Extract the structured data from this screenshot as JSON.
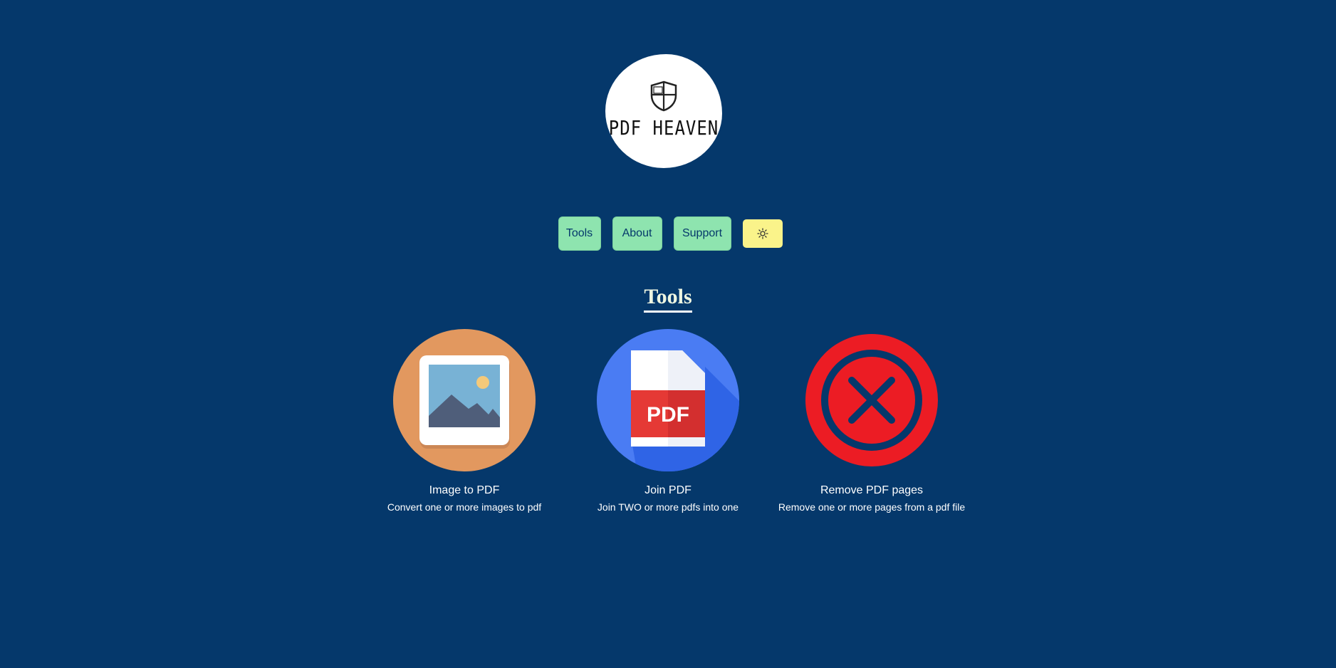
{
  "logo": {
    "text": "PDF HEAVEN",
    "icon": "shield-icon"
  },
  "nav": {
    "items": [
      {
        "label": "Tools"
      },
      {
        "label": "About"
      },
      {
        "label": "Support"
      }
    ],
    "theme_toggle": {
      "icon": "sun-icon"
    }
  },
  "section": {
    "title": "Tools"
  },
  "tools": [
    {
      "name": "Image to PDF",
      "description": "Convert one or more images to pdf",
      "icon": "image-icon",
      "color": "#e2985f"
    },
    {
      "name": "Join PDF",
      "description": "Join TWO or more pdfs into one",
      "icon": "pdf-file-icon",
      "color": "#4a7cf3"
    },
    {
      "name": "Remove PDF pages",
      "description": "Remove one or more pages from a pdf file",
      "icon": "close-circle-icon",
      "color": "#ec1c24"
    }
  ],
  "colors": {
    "background": "#05386b",
    "nav_button": "#8ee4af",
    "theme_button": "#faf38a"
  }
}
